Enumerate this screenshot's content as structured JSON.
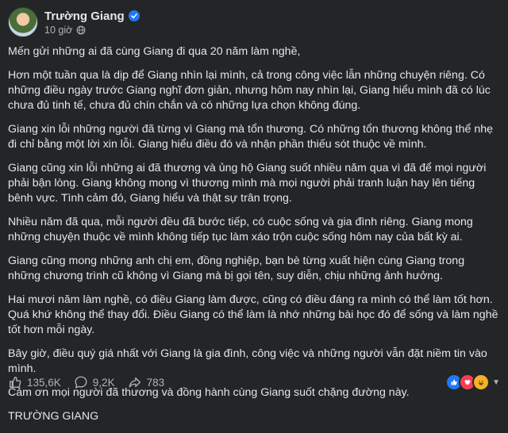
{
  "post": {
    "author": "Trường Giang",
    "time": "10 giờ",
    "paragraphs": [
      "Mến gửi những ai đã cùng Giang đi qua 20 năm làm nghề,",
      "Hơn một tuần qua là dịp để Giang nhìn lại mình, cả trong công việc lẫn những chuyện riêng. Có những điều ngày trước Giang nghĩ đơn giản, nhưng hôm nay nhìn lại, Giang hiểu mình đã có lúc chưa đủ tinh tế, chưa đủ chín chắn và có những lựa chọn không đúng.",
      "Giang xin lỗi những người đã từng vì Giang mà tổn thương. Có những tổn thương không thể nhẹ đi chỉ bằng một lời xin lỗi. Giang hiểu điều đó và nhận phần thiếu sót thuộc về mình.",
      "Giang cũng xin lỗi những ai đã thương và ủng hộ Giang suốt nhiều năm qua vì đã để mọi người phải bận lòng. Giang không mong vì thương mình mà mọi người phải tranh luận hay lên tiếng bênh vực. Tình cảm đó, Giang hiểu và thật sự trân trọng.",
      "Nhiều năm đã qua, mỗi người đều đã bước tiếp, có cuộc sống và gia đình riêng. Giang mong những chuyện thuộc về mình không tiếp tục làm xáo trộn cuộc sống hôm nay của bất kỳ ai.",
      "Giang cũng mong những anh chị em, đồng nghiệp, bạn bè từng xuất hiện cùng Giang trong những chương trình cũ không vì Giang mà bị gọi tên, suy diễn, chịu những ảnh hưởng.",
      "Hai mươi năm làm nghề, có điều Giang làm được, cũng có điều đáng ra mình có thể làm tốt hơn. Quá khứ không thể thay đổi. Điều Giang có thể làm là nhớ những bài học đó để sống và làm nghề tốt hơn mỗi ngày.",
      "Bây giờ, điều quý giá nhất với Giang là gia đình, công việc và những người vẫn đặt niềm tin vào mình.",
      "Cảm ơn mọi người đã thương và đồng hành cùng Giang suốt chặng đường này.",
      "TRƯỜNG GIANG"
    ]
  },
  "stats": {
    "likes": "135,6K",
    "comments": "9,2K",
    "shares": "783"
  },
  "icons": {
    "verified": "verified-badge-icon",
    "privacy": "globe-icon",
    "like": "thumbs-up-icon",
    "comment": "comment-icon",
    "share": "share-icon"
  },
  "colors": {
    "background": "#242526",
    "text": "#e4e6eb",
    "secondary": "#b0b3b8",
    "accent": "#2078f4"
  }
}
